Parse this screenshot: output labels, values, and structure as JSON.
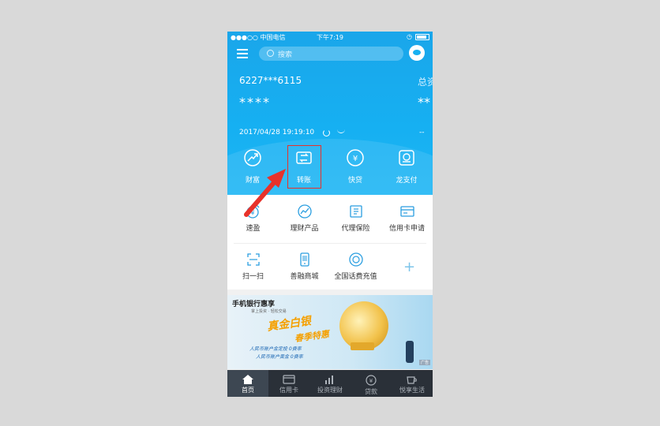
{
  "status": {
    "carrier": "●●●○○ 中国电信",
    "time": "下午7:19"
  },
  "search": {
    "placeholder": "搜索"
  },
  "account": {
    "number": "6227***6115",
    "balance_mask": "****",
    "total_label": "总资",
    "total_mask": "**",
    "timestamp": "2017/04/28 19:19:10",
    "extra": "--"
  },
  "quick_actions": [
    {
      "label": "财富",
      "icon": "trend-up-icon"
    },
    {
      "label": "转账",
      "icon": "transfer-icon"
    },
    {
      "label": "快贷",
      "icon": "loan-icon"
    },
    {
      "label": "龙支付",
      "icon": "dragon-pay-icon"
    }
  ],
  "services": [
    {
      "label": "速盈",
      "icon": "yuan-up-icon"
    },
    {
      "label": "理财产品",
      "icon": "chart-icon"
    },
    {
      "label": "代理保险",
      "icon": "insurance-icon"
    },
    {
      "label": "信用卡申请",
      "icon": "credit-card-apply-icon"
    },
    {
      "label": "扫一扫",
      "icon": "scan-icon"
    },
    {
      "label": "善融商城",
      "icon": "mall-icon"
    },
    {
      "label": "全国话费充值",
      "icon": "phone-recharge-icon"
    }
  ],
  "banner": {
    "title": "手机银行惠享",
    "subtitle": "掌上投资 · 轻松交易",
    "headline1": "真金白银",
    "headline2": "春季特惠",
    "line1": "人民币账户金定投 0费率",
    "line2": "人民币账户黄金 0费率",
    "tag": "广告"
  },
  "tabs": [
    {
      "label": "首页",
      "icon": "home-icon",
      "active": true
    },
    {
      "label": "信用卡",
      "icon": "credit-card-icon"
    },
    {
      "label": "投资理财",
      "icon": "bar-chart-icon"
    },
    {
      "label": "贷款",
      "icon": "yuan-icon"
    },
    {
      "label": "悦享生活",
      "icon": "coffee-icon"
    }
  ],
  "colors": {
    "header_blue": "#16b0f2",
    "highlight_red": "#e8322b",
    "icon_blue": "#2a9ee0",
    "tabbar": "#2a3038"
  }
}
